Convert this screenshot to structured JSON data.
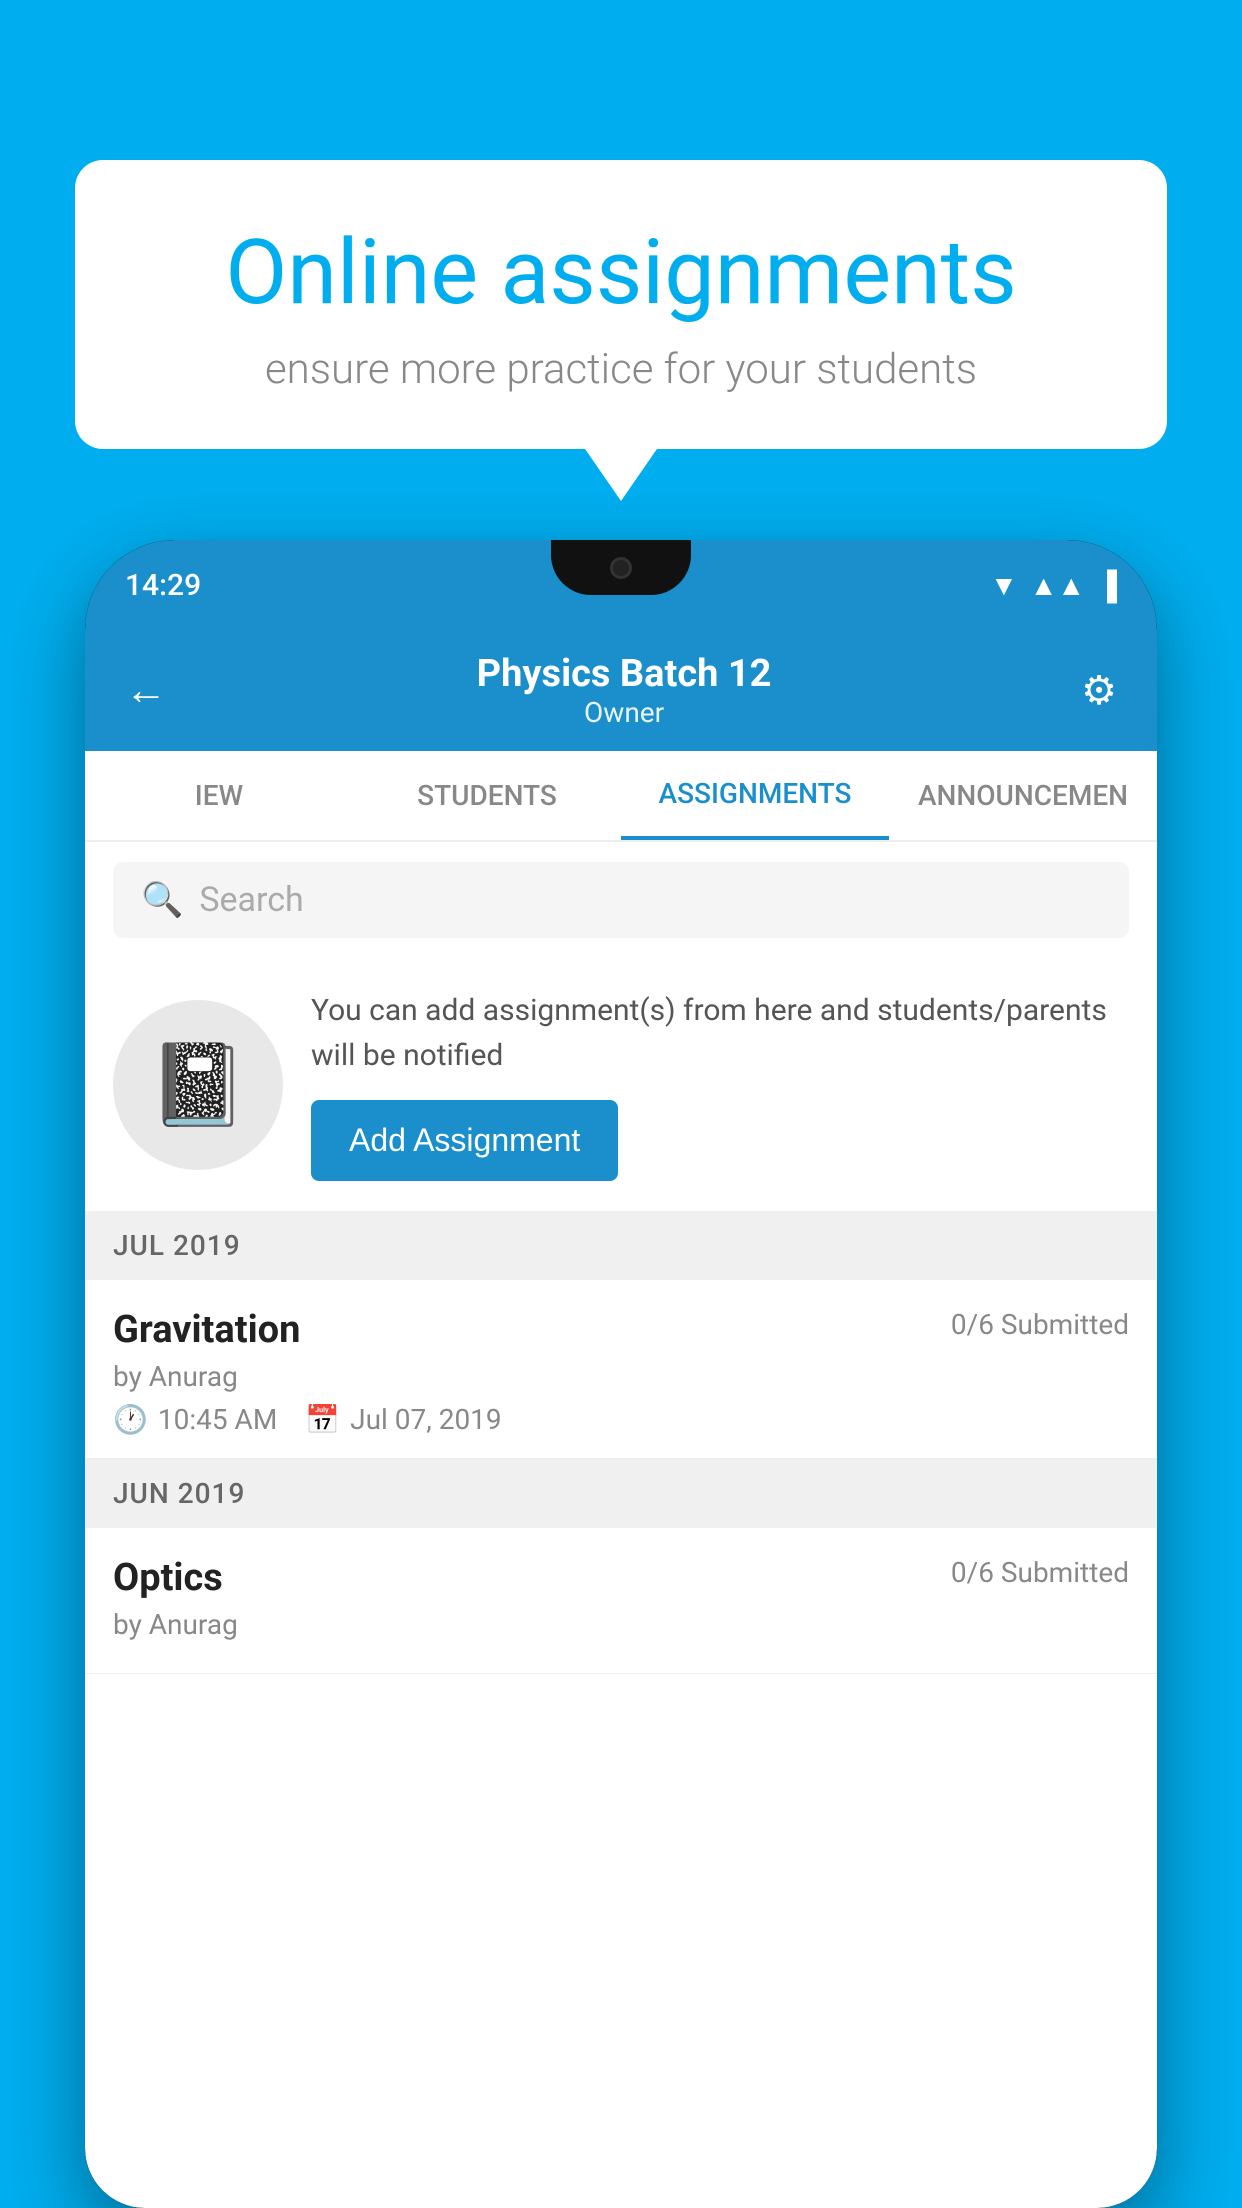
{
  "background_color": "#00AEEF",
  "bubble": {
    "title": "Online assignments",
    "subtitle": "ensure more practice for your students"
  },
  "phone": {
    "status_time": "14:29",
    "status_icons": [
      "wifi",
      "signal",
      "battery"
    ]
  },
  "header": {
    "title": "Physics Batch 12",
    "subtitle": "Owner",
    "back_label": "←",
    "gear_label": "⚙"
  },
  "tabs": [
    {
      "label": "IEW",
      "active": false
    },
    {
      "label": "STUDENTS",
      "active": false
    },
    {
      "label": "ASSIGNMENTS",
      "active": true
    },
    {
      "label": "ANNOUNCEMENTS",
      "active": false
    }
  ],
  "search": {
    "placeholder": "Search"
  },
  "promo": {
    "description": "You can add assignment(s) from here and students/parents will be notified",
    "button_label": "Add Assignment"
  },
  "sections": [
    {
      "label": "JUL 2019",
      "assignments": [
        {
          "name": "Gravitation",
          "submitted": "0/6 Submitted",
          "author": "by Anurag",
          "time": "10:45 AM",
          "date": "Jul 07, 2019"
        }
      ]
    },
    {
      "label": "JUN 2019",
      "assignments": [
        {
          "name": "Optics",
          "submitted": "0/6 Submitted",
          "author": "by Anurag",
          "time": "",
          "date": ""
        }
      ]
    }
  ]
}
